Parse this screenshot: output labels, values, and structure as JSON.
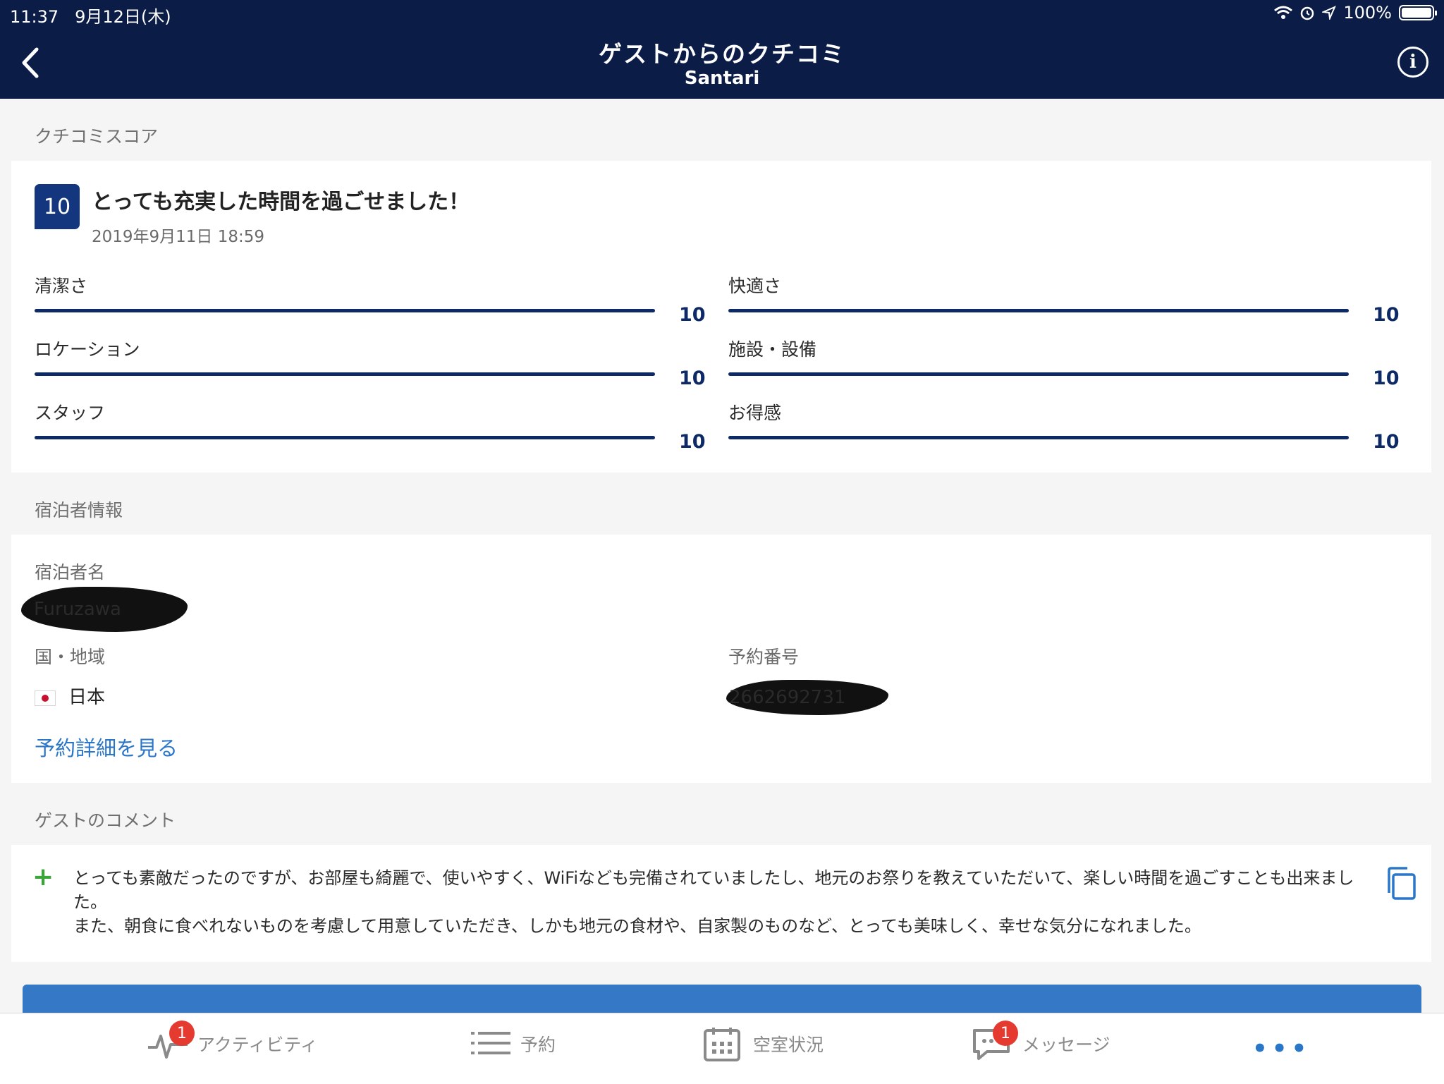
{
  "status_bar": {
    "time": "11:37",
    "date": "9月12日(木)",
    "battery": "100%"
  },
  "header": {
    "title": "ゲストからのクチコミ",
    "subtitle": "Santari"
  },
  "review_section": {
    "label": "クチコミスコア",
    "score": "10",
    "title": "とっても充実した時間を過ごせました！",
    "date": "2019年9月11日 18:59",
    "categories": [
      {
        "label": "清潔さ",
        "value": "10",
        "fraction": 1.0
      },
      {
        "label": "快適さ",
        "value": "10",
        "fraction": 1.0
      },
      {
        "label": "ロケーション",
        "value": "10",
        "fraction": 1.0
      },
      {
        "label": "施設・設備",
        "value": "10",
        "fraction": 1.0
      },
      {
        "label": "スタッフ",
        "value": "10",
        "fraction": 1.0
      },
      {
        "label": "お得感",
        "value": "10",
        "fraction": 1.0
      }
    ]
  },
  "guest_section": {
    "label": "宿泊者情報",
    "name_label": "宿泊者名",
    "name_value": "Furuzawa",
    "country_label": "国・地域",
    "country_value": "日本",
    "booking_label": "予約番号",
    "booking_value": "2662692731",
    "details_link": "予約詳細を見る"
  },
  "comment_section": {
    "label": "ゲストのコメント",
    "text": "とっても素敵だったのですが、お部屋も綺麗で、使いやすく、WiFiなども完備されていましたし、地元のお祭りを教えていただいて、楽しい時間を過ごすことも出来ました。\nまた、朝食に食べれないものを考慮して用意していただき、しかも地元の食材や、自家製のものなど、とっても美味しく、幸せな気分になれました。"
  },
  "tabs": [
    {
      "label": "アクティビティ",
      "badge": "1",
      "icon": "activity-icon"
    },
    {
      "label": "予約",
      "icon": "list-icon"
    },
    {
      "label": "空室状況",
      "icon": "calendar-icon"
    },
    {
      "label": "メッセージ",
      "badge": "1",
      "icon": "chat-icon"
    }
  ],
  "more_label": "•••",
  "colors": {
    "header_bg": "#0b1c47",
    "accent": "#2a76c9",
    "score": "#14367e",
    "badge": "#e53a2f"
  }
}
